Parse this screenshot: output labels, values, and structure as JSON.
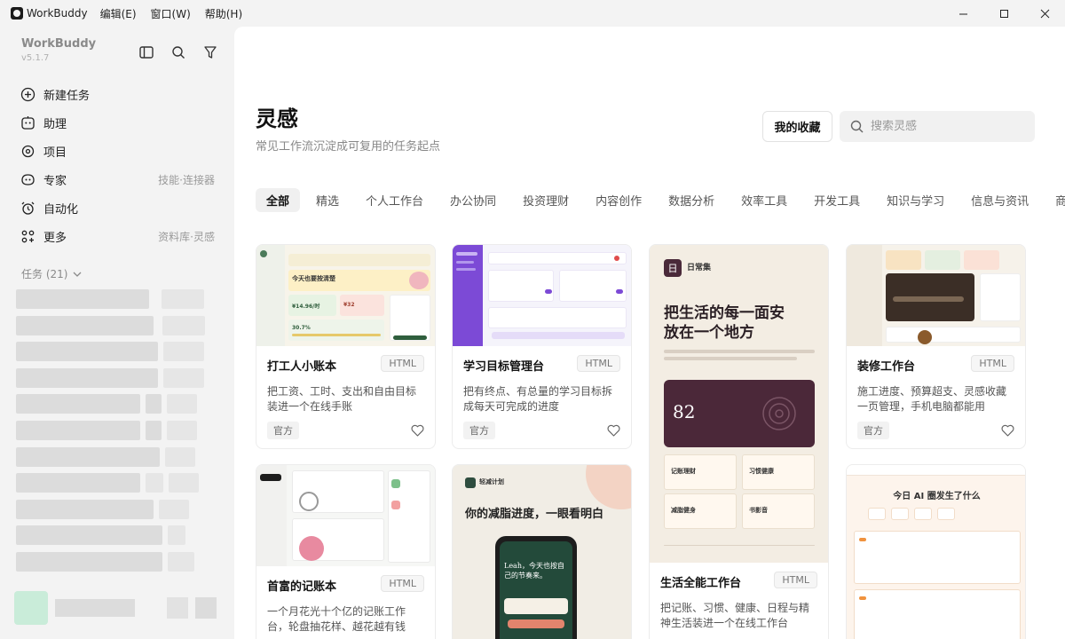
{
  "app": {
    "title": "WorkBuddy",
    "menu": [
      "编辑(E)",
      "窗口(W)",
      "帮助(H)"
    ],
    "window_controls": [
      "minimize-icon",
      "maximize-icon",
      "close-icon"
    ]
  },
  "sidebar": {
    "brand": "WorkBuddy",
    "version": "v5.1.7",
    "tools": [
      "sidebar-toggle-icon",
      "search-icon",
      "filter-icon"
    ],
    "nav": [
      {
        "label": "新建任务",
        "icon": "plus-circle-icon",
        "hint": ""
      },
      {
        "label": "助理",
        "icon": "assistant-icon",
        "hint": ""
      },
      {
        "label": "项目",
        "icon": "project-icon",
        "hint": ""
      },
      {
        "label": "专家",
        "icon": "expert-icon",
        "hint": "技能·连接器"
      },
      {
        "label": "自动化",
        "icon": "alarm-clock-icon",
        "hint": ""
      },
      {
        "label": "更多",
        "icon": "grid-more-icon",
        "hint": "资料库·灵感"
      }
    ],
    "tasks_header": "任务 (21)"
  },
  "main": {
    "title": "灵感",
    "subtitle": "常见工作流沉淀成可复用的任务起点",
    "favorites_label": "我的收藏",
    "search_placeholder": "搜索灵感",
    "tabs": [
      "全部",
      "精选",
      "个人工作台",
      "办公协同",
      "投资理财",
      "内容创作",
      "数据分析",
      "效率工具",
      "开发工具",
      "知识与学习",
      "信息与资讯",
      "商"
    ],
    "active_tab": "全部"
  },
  "cards": [
    {
      "title": "打工人小账本",
      "badge": "HTML",
      "desc": "把工资、工时、支出和自由目标装进一个在线手账",
      "tag": "官方",
      "thumb": {
        "heading": "今天也要按清楚",
        "value1": "¥14.96/时",
        "value2": "¥32",
        "value3": "30.7%"
      }
    },
    {
      "title": "学习目标管理台",
      "badge": "HTML",
      "desc": "把有终点、有总量的学习目标拆成每天可完成的进度",
      "tag": "官方"
    },
    {
      "title": "生活全能工作台",
      "badge": "HTML",
      "desc": "把记账、习惯、健康、日程与精神生活装进一个在线工作台",
      "tag": "",
      "thumb": {
        "logo": "日",
        "brand": "日常集",
        "headline": "把生活的每一面安放在一个地方",
        "score": "82",
        "tiles": [
          "记账理财",
          "习惯健康",
          "减脂健身",
          "书影音"
        ]
      }
    },
    {
      "title": "装修工作台",
      "badge": "HTML",
      "desc": "施工进度、预算超支、灵感收藏一页管理，手机电脑都能用",
      "tag": "官方"
    },
    {
      "title": "首富的记账本",
      "badge": "HTML",
      "desc": "一个月花光十个亿的记账工作台，轮盘抽花样、越花越有钱",
      "tag": ""
    },
    {
      "title": "",
      "badge": "",
      "desc": "",
      "tag": "",
      "thumb": {
        "brand": "轻减计划",
        "headline": "你的减脂进度，一眼看明白",
        "phone_text": "Leah，今天也按自己的节奏来。"
      }
    },
    {
      "title": "",
      "badge": "",
      "desc": "",
      "tag": "",
      "thumb": {
        "headline": "今日 AI 圈发生了什么",
        "accent": "AI"
      }
    }
  ]
}
